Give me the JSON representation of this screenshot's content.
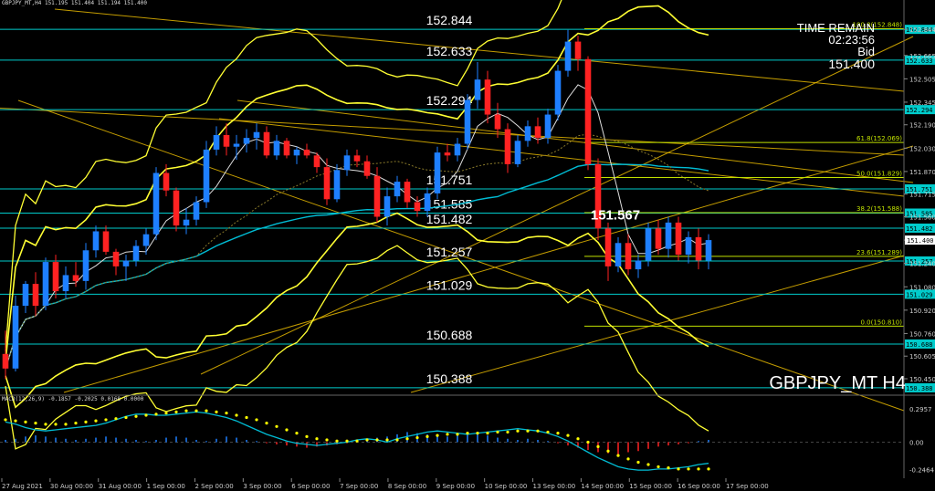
{
  "window": {
    "symbol_line": "GBPJPY_MT,H4  151.195 151.404 151.194 151.400",
    "instrument": "GBPJPY_MT H4",
    "time_remain_label": "TIME REMAIN",
    "time_remain_value": "02:23:56",
    "bid_label": "Bid",
    "bid_value": "151.400",
    "macd_label": "MACD(12,26,9) -0.1857 -0.2025 0.0168 0.0000",
    "current_marker": "151.567"
  },
  "colors": {
    "background": "#000000",
    "bull": "#1e7fff",
    "bear": "#ff2222",
    "level": "#00cccc",
    "fib": "#c0e000",
    "trend": "#e6b800",
    "bollinger": "#ffff33",
    "ma": "#00bcd4",
    "macd_signal": "#ffff00"
  },
  "chart_data": {
    "type": "candlestick",
    "instrument": "GBPJPY_MT",
    "timeframe": "H4",
    "ylim": [
      150.35,
      153.02
    ],
    "y_ticks": [
      "152.844",
      "152.665",
      "152.505",
      "152.345",
      "152.190",
      "152.030",
      "151.870",
      "151.715",
      "151.560",
      "151.400",
      "151.240",
      "151.080",
      "150.920",
      "150.760",
      "150.605",
      "150.450"
    ],
    "x_ticks": [
      "27 Aug 2021",
      "30 Aug 00:00",
      "31 Aug 00:00",
      "1 Sep 00:00",
      "2 Sep 00:00",
      "3 Sep 00:00",
      "6 Sep 00:00",
      "7 Sep 00:00",
      "8 Sep 00:00",
      "9 Sep 00:00",
      "10 Sep 00:00",
      "13 Sep 00:00",
      "14 Sep 00:00",
      "15 Sep 00:00",
      "16 Sep 00:00",
      "17 Sep 00:00"
    ],
    "candles": [
      [
        150.62,
        150.78,
        150.45,
        150.52
      ],
      [
        150.52,
        151.02,
        150.5,
        150.95
      ],
      [
        150.95,
        151.12,
        150.9,
        151.1
      ],
      [
        151.1,
        151.18,
        150.88,
        150.95
      ],
      [
        150.95,
        151.28,
        150.92,
        151.25
      ],
      [
        151.25,
        151.3,
        151.0,
        151.05
      ],
      [
        151.05,
        151.22,
        151.0,
        151.16
      ],
      [
        151.16,
        151.25,
        151.08,
        151.12
      ],
      [
        151.12,
        151.38,
        151.06,
        151.33
      ],
      [
        151.33,
        151.5,
        151.28,
        151.46
      ],
      [
        151.46,
        151.5,
        151.3,
        151.32
      ],
      [
        151.32,
        151.34,
        151.16,
        151.22
      ],
      [
        151.22,
        151.3,
        151.12,
        151.26
      ],
      [
        151.26,
        151.4,
        151.22,
        151.36
      ],
      [
        151.36,
        151.48,
        151.3,
        151.44
      ],
      [
        151.44,
        151.9,
        151.4,
        151.86
      ],
      [
        151.86,
        151.92,
        151.7,
        151.74
      ],
      [
        151.74,
        151.76,
        151.46,
        151.5
      ],
      [
        151.5,
        151.62,
        151.44,
        151.54
      ],
      [
        151.54,
        151.7,
        151.5,
        151.66
      ],
      [
        151.66,
        152.08,
        151.62,
        152.02
      ],
      [
        152.02,
        152.18,
        151.98,
        152.12
      ],
      [
        152.12,
        152.2,
        151.98,
        152.04
      ],
      [
        152.04,
        152.12,
        151.95,
        152.06
      ],
      [
        152.06,
        152.16,
        152.0,
        152.1
      ],
      [
        152.1,
        152.2,
        152.02,
        152.14
      ],
      [
        152.14,
        152.18,
        151.96,
        151.98
      ],
      [
        151.98,
        152.12,
        151.95,
        152.08
      ],
      [
        152.08,
        152.1,
        151.96,
        151.98
      ],
      [
        151.98,
        152.04,
        151.92,
        152.02
      ],
      [
        152.02,
        152.06,
        151.96,
        151.98
      ],
      [
        151.98,
        152.0,
        151.86,
        151.9
      ],
      [
        151.9,
        151.96,
        151.64,
        151.68
      ],
      [
        151.68,
        151.92,
        151.66,
        151.88
      ],
      [
        151.88,
        152.02,
        151.84,
        151.98
      ],
      [
        151.98,
        152.02,
        151.9,
        151.94
      ],
      [
        151.94,
        151.98,
        151.82,
        151.84
      ],
      [
        151.84,
        151.9,
        151.52,
        151.56
      ],
      [
        151.56,
        151.76,
        151.5,
        151.7
      ],
      [
        151.7,
        151.84,
        151.66,
        151.8
      ],
      [
        151.8,
        151.82,
        151.62,
        151.66
      ],
      [
        151.66,
        151.7,
        151.56,
        151.6
      ],
      [
        151.6,
        151.76,
        151.56,
        151.72
      ],
      [
        151.72,
        152.04,
        151.68,
        152.0
      ],
      [
        152.0,
        152.06,
        151.94,
        151.98
      ],
      [
        151.98,
        152.1,
        151.94,
        152.06
      ],
      [
        152.06,
        152.4,
        152.02,
        152.36
      ],
      [
        152.36,
        152.62,
        152.3,
        152.5
      ],
      [
        152.5,
        152.56,
        152.2,
        152.26
      ],
      [
        152.26,
        152.34,
        152.1,
        152.16
      ],
      [
        152.16,
        152.2,
        151.86,
        151.92
      ],
      [
        151.92,
        152.12,
        151.9,
        152.08
      ],
      [
        152.08,
        152.22,
        152.04,
        152.18
      ],
      [
        152.18,
        152.24,
        152.06,
        152.1
      ],
      [
        152.1,
        152.3,
        152.06,
        152.26
      ],
      [
        152.26,
        152.6,
        152.22,
        152.56
      ],
      [
        152.56,
        152.84,
        152.52,
        152.76
      ],
      [
        152.76,
        152.8,
        152.56,
        152.64
      ],
      [
        152.64,
        152.66,
        151.88,
        151.92
      ],
      [
        151.92,
        151.96,
        151.4,
        151.48
      ],
      [
        151.48,
        151.52,
        151.12,
        151.22
      ],
      [
        151.22,
        151.42,
        151.18,
        151.38
      ],
      [
        151.38,
        151.44,
        151.16,
        151.2
      ],
      [
        151.2,
        151.3,
        151.14,
        151.26
      ],
      [
        151.26,
        151.52,
        151.22,
        151.48
      ],
      [
        151.48,
        151.54,
        151.3,
        151.34
      ],
      [
        151.34,
        151.56,
        151.28,
        151.52
      ],
      [
        151.52,
        151.56,
        151.26,
        151.3
      ],
      [
        151.3,
        151.46,
        151.24,
        151.42
      ],
      [
        151.42,
        151.48,
        151.2,
        151.26
      ],
      [
        151.26,
        151.44,
        151.2,
        151.4
      ]
    ],
    "price_levels": [
      {
        "label": "152.844",
        "value": 152.844
      },
      {
        "label": "152.633",
        "value": 152.633
      },
      {
        "label": "152.294",
        "value": 152.294
      },
      {
        "label": "151.751",
        "value": 151.751
      },
      {
        "label": "151.585",
        "value": 151.585
      },
      {
        "label": "151.482",
        "value": 151.482
      },
      {
        "label": "151.257",
        "value": 151.257
      },
      {
        "label": "151.029",
        "value": 151.029
      },
      {
        "label": "150.688",
        "value": 150.688
      },
      {
        "label": "150.388",
        "value": 150.388
      }
    ],
    "fibonacci": [
      {
        "label": "100.0(152.848)",
        "value": 152.848
      },
      {
        "label": "61.8(152.069)",
        "value": 152.069
      },
      {
        "label": "50.0(151.829)",
        "value": 151.829
      },
      {
        "label": "38.2(151.588)",
        "value": 151.588
      },
      {
        "label": "23.6(151.289)",
        "value": 151.289
      },
      {
        "label": "0.0(150.810)",
        "value": 150.81
      }
    ],
    "macd": {
      "ylim": [
        -0.29,
        0.33
      ],
      "y_ticks": [
        "0.2957",
        "0.00",
        "-0.2464"
      ],
      "histogram": [
        0.02,
        0.03,
        0.05,
        0.06,
        0.05,
        0.04,
        0.03,
        0.02,
        0.03,
        0.04,
        0.05,
        0.04,
        0.03,
        0.02,
        0.01,
        0.02,
        0.04,
        0.05,
        0.04,
        0.02,
        0.01,
        0.03,
        0.05,
        0.04,
        0.02,
        0.01,
        -0.01,
        -0.02,
        -0.03,
        -0.04,
        -0.05,
        -0.04,
        -0.03,
        -0.02,
        -0.01,
        0.01,
        0.02,
        0.04,
        0.05,
        0.07,
        0.09,
        0.08,
        0.07,
        0.06,
        0.05,
        0.06,
        0.07,
        0.08,
        0.06,
        0.04,
        0.03,
        0.02,
        0.03,
        0.02,
        0.01,
        -0.01,
        -0.03,
        -0.05,
        -0.07,
        -0.09,
        -0.1,
        -0.11,
        -0.09,
        -0.08,
        -0.06,
        -0.04,
        -0.03,
        -0.02,
        -0.01,
        0.01,
        0.02
      ],
      "macd_line": [
        0.18,
        0.16,
        0.13,
        0.11,
        0.1,
        0.11,
        0.12,
        0.13,
        0.14,
        0.15,
        0.17,
        0.2,
        0.23,
        0.25,
        0.25,
        0.24,
        0.24,
        0.25,
        0.26,
        0.27,
        0.26,
        0.24,
        0.22,
        0.19,
        0.15,
        0.11,
        0.07,
        0.04,
        0.01,
        -0.01,
        -0.02,
        -0.03,
        -0.02,
        -0.01,
        0.0,
        0.02,
        0.03,
        0.02,
        0.0,
        0.03,
        0.05,
        0.07,
        0.09,
        0.1,
        0.09,
        0.08,
        0.07,
        0.08,
        0.09,
        0.1,
        0.11,
        0.12,
        0.11,
        0.1,
        0.08,
        0.05,
        0.01,
        -0.04,
        -0.09,
        -0.14,
        -0.18,
        -0.22,
        -0.24,
        -0.25,
        -0.25,
        -0.24,
        -0.24,
        -0.23,
        -0.22,
        -0.2,
        -0.19
      ],
      "signal_line": [
        0.2,
        0.19,
        0.18,
        0.17,
        0.16,
        0.16,
        0.16,
        0.17,
        0.18,
        0.19,
        0.2,
        0.21,
        0.22,
        0.23,
        0.24,
        0.25,
        0.26,
        0.27,
        0.28,
        0.28,
        0.28,
        0.27,
        0.26,
        0.24,
        0.22,
        0.2,
        0.17,
        0.14,
        0.11,
        0.08,
        0.05,
        0.03,
        0.02,
        0.01,
        0.01,
        0.01,
        0.02,
        0.02,
        0.02,
        0.02,
        0.03,
        0.04,
        0.05,
        0.06,
        0.07,
        0.07,
        0.08,
        0.08,
        0.08,
        0.09,
        0.09,
        0.1,
        0.1,
        0.1,
        0.09,
        0.08,
        0.06,
        0.03,
        0.0,
        -0.04,
        -0.08,
        -0.12,
        -0.15,
        -0.18,
        -0.2,
        -0.22,
        -0.23,
        -0.24,
        -0.24,
        -0.24,
        -0.24
      ]
    },
    "grid": false,
    "legend": "none"
  }
}
